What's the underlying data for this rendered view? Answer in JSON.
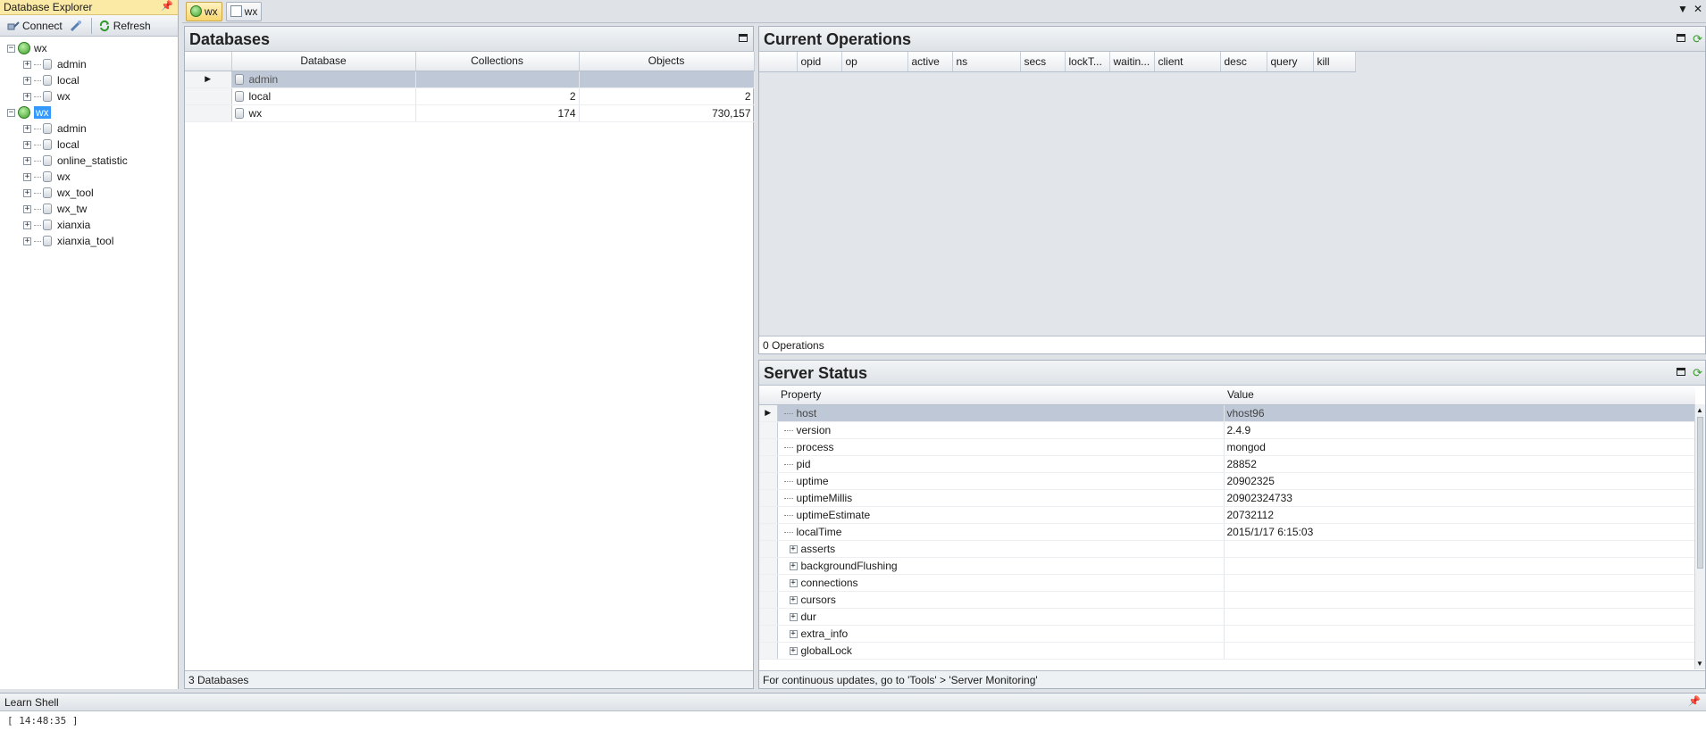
{
  "explorer": {
    "title": "Database Explorer",
    "pin_glyph": "📌",
    "toolbar": {
      "connect_label": "Connect",
      "refresh_label": "Refresh"
    },
    "tree": [
      {
        "name": "wx",
        "selected": false,
        "children": [
          "admin",
          "local",
          "wx"
        ]
      },
      {
        "name": "wx",
        "selected": true,
        "children": [
          "admin",
          "local",
          "online_statistic",
          "wx",
          "wx_tool",
          "wx_tw",
          "xianxia",
          "xianxia_tool"
        ]
      }
    ]
  },
  "tabs": [
    {
      "label": "wx",
      "icon": "server-icon",
      "active": true
    },
    {
      "label": "wx",
      "icon": "document-icon",
      "active": false
    }
  ],
  "databases": {
    "title": "Databases",
    "columns": [
      "Database",
      "Collections",
      "Objects"
    ],
    "rows": [
      {
        "name": "admin",
        "collections": "",
        "objects": "",
        "selected": true
      },
      {
        "name": "local",
        "collections": "2",
        "objects": "2",
        "selected": false
      },
      {
        "name": "wx",
        "collections": "174",
        "objects": "730,157",
        "selected": false
      }
    ],
    "footer": "3 Databases"
  },
  "operations": {
    "title": "Current Operations",
    "columns": [
      "opid",
      "op",
      "active",
      "ns",
      "secs",
      "lockT...",
      "waitin...",
      "client",
      "desc",
      "query",
      "kill"
    ],
    "footer": "0 Operations"
  },
  "server_status": {
    "title": "Server Status",
    "columns": [
      "Property",
      "Value"
    ],
    "rows": [
      {
        "property": "host",
        "value": "vhost96",
        "expandable": false,
        "selected": true
      },
      {
        "property": "version",
        "value": "2.4.9",
        "expandable": false
      },
      {
        "property": "process",
        "value": "mongod",
        "expandable": false
      },
      {
        "property": "pid",
        "value": "28852",
        "expandable": false
      },
      {
        "property": "uptime",
        "value": "20902325",
        "expandable": false
      },
      {
        "property": "uptimeMillis",
        "value": "20902324733",
        "expandable": false
      },
      {
        "property": "uptimeEstimate",
        "value": "20732112",
        "expandable": false
      },
      {
        "property": "localTime",
        "value": "2015/1/17 6:15:03",
        "expandable": false
      },
      {
        "property": "asserts",
        "value": "",
        "expandable": true
      },
      {
        "property": "backgroundFlushing",
        "value": "",
        "expandable": true
      },
      {
        "property": "connections",
        "value": "",
        "expandable": true
      },
      {
        "property": "cursors",
        "value": "",
        "expandable": true
      },
      {
        "property": "dur",
        "value": "",
        "expandable": true
      },
      {
        "property": "extra_info",
        "value": "",
        "expandable": true
      },
      {
        "property": "globalLock",
        "value": "",
        "expandable": true
      }
    ],
    "footer": "For continuous updates, go to 'Tools' > 'Server Monitoring'"
  },
  "shell": {
    "title": "Learn Shell",
    "text": "[ 14:48:35 ]"
  },
  "colors": {
    "accent_tab": "#f8d76e",
    "selection": "#3399ff",
    "row_selected": "#bfc8d6"
  }
}
